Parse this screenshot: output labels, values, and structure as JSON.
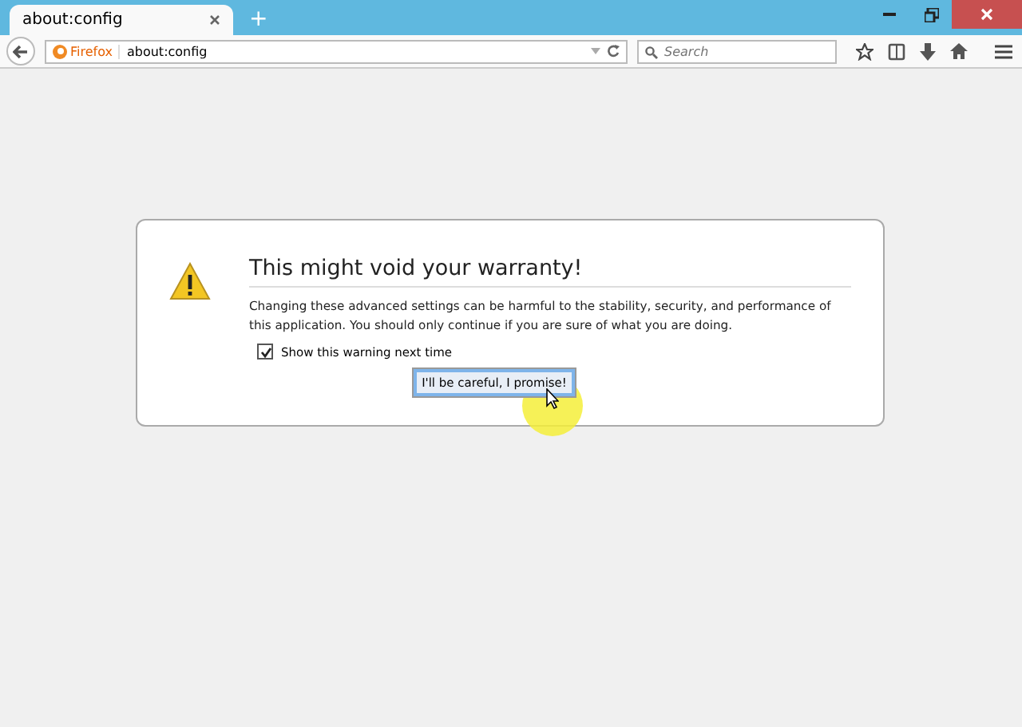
{
  "tabs": [
    {
      "label": "about:config",
      "selected": true
    }
  ],
  "new_tab": "+",
  "address_bar": {
    "identity": "Firefox",
    "url": "about:config"
  },
  "search": {
    "placeholder": "Search"
  },
  "dialog": {
    "title": "This might void your warranty!",
    "message": "Changing these advanced settings can be harmful to the stability, security, and performance of this application. You should only continue if you are sure of what you are doing.",
    "checkbox": {
      "label": "Show this warning next time",
      "checked": true
    },
    "button": "I'll be careful, I promise!"
  }
}
